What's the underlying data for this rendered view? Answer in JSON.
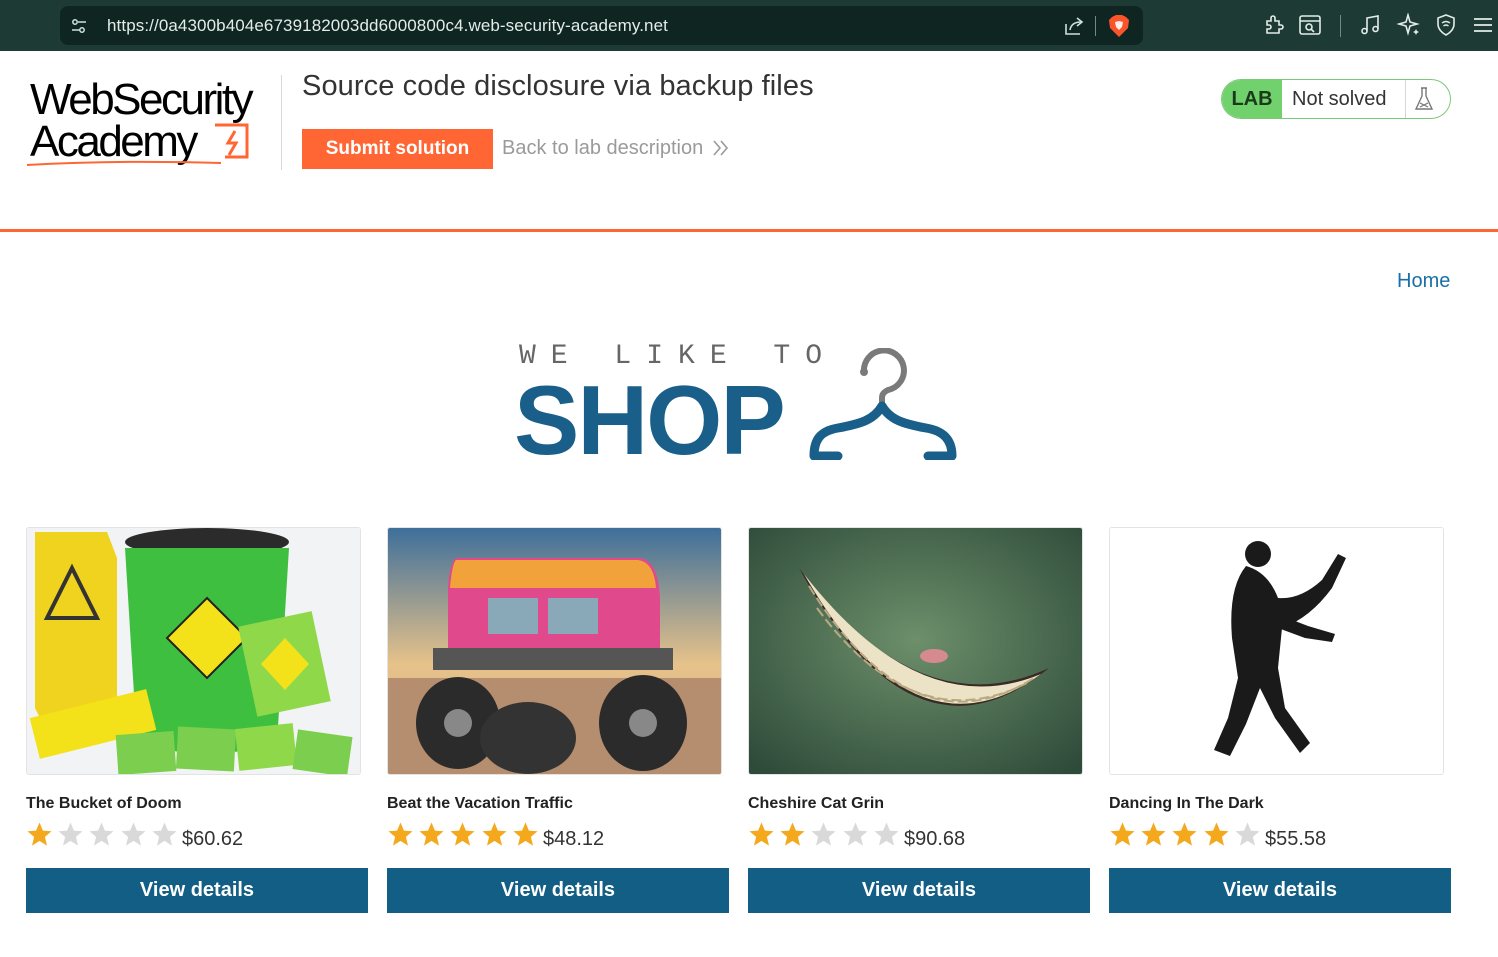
{
  "browser": {
    "url": "https://0a4300b404e6739182003dd6000800c4.web-security-academy.net",
    "icons": [
      "site-settings-icon",
      "share-icon",
      "brave-shields-icon",
      "extensions-icon",
      "reader-icon",
      "media-icon",
      "leo-ai-icon",
      "vpn-icon",
      "menu-icon"
    ]
  },
  "lab": {
    "logo_line1": "WebSecurity",
    "logo_line2": "Academy",
    "title": "Source code disclosure via backup files",
    "submit_label": "Submit solution",
    "back_label": "Back to lab description",
    "status_badge": "LAB",
    "status_text": "Not solved",
    "accent_color": "#ff6633",
    "status_color": "#70d16d"
  },
  "shop": {
    "home_label": "Home",
    "banner_top": "WE LIKE TO",
    "banner_main": "SHOP",
    "brand_color": "#1a5f89",
    "button_color": "#135e85",
    "products": [
      {
        "name": "The Bucket of Doom",
        "rating": 1,
        "price": "$60.62",
        "button": "View details"
      },
      {
        "name": "Beat the Vacation Traffic",
        "rating": 5,
        "price": "$48.12",
        "button": "View details"
      },
      {
        "name": "Cheshire Cat Grin",
        "rating": 2,
        "price": "$90.68",
        "button": "View details"
      },
      {
        "name": "Dancing In The Dark",
        "rating": 4,
        "price": "$55.58",
        "button": "View details"
      }
    ]
  }
}
